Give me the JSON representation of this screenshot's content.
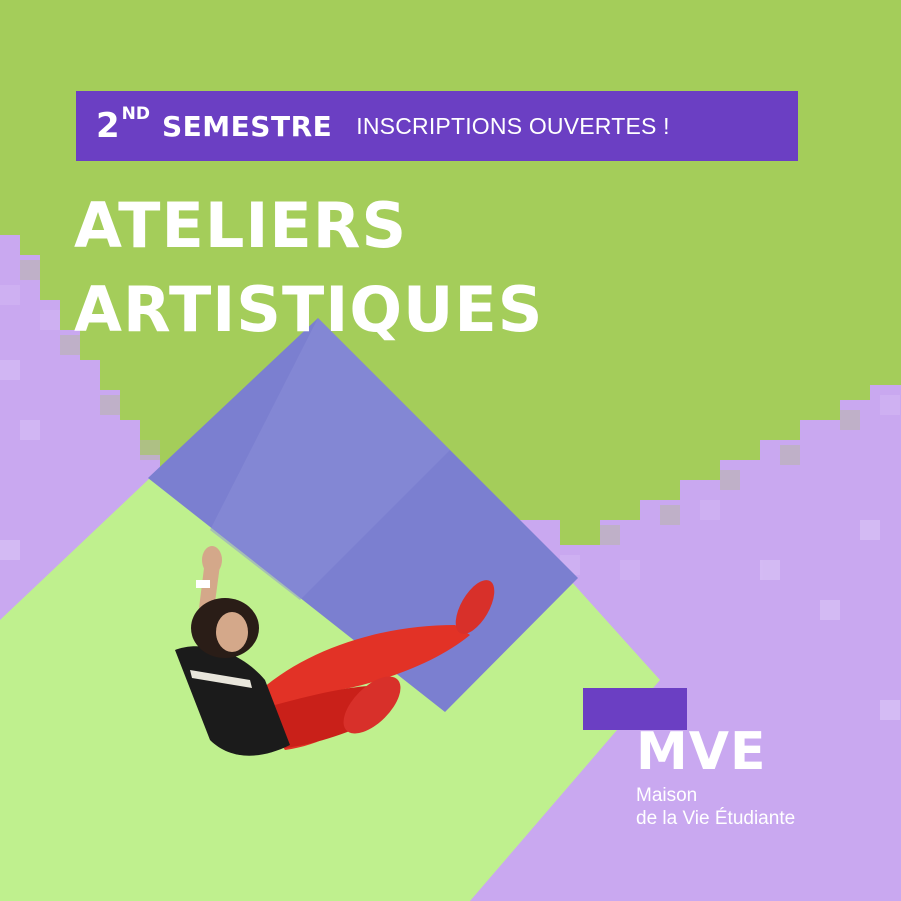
{
  "colors": {
    "green": "#a4cd5a",
    "light_green": "#bff08e",
    "lavender": "#c9a8f0",
    "purple": "#6b3fc3",
    "sky": "#7b7fd0",
    "white": "#ffffff"
  },
  "banner": {
    "number": "2",
    "ordinal": "ND",
    "semester": "SEMESTRE",
    "registration": "INSCRIPTIONS OUVERTES !"
  },
  "title": {
    "line1": "ATELIERS",
    "line2": "ARTISTIQUES"
  },
  "logo": {
    "acronym": "MVE",
    "line1": "Maison",
    "line2": "de la Vie Étudiante"
  }
}
